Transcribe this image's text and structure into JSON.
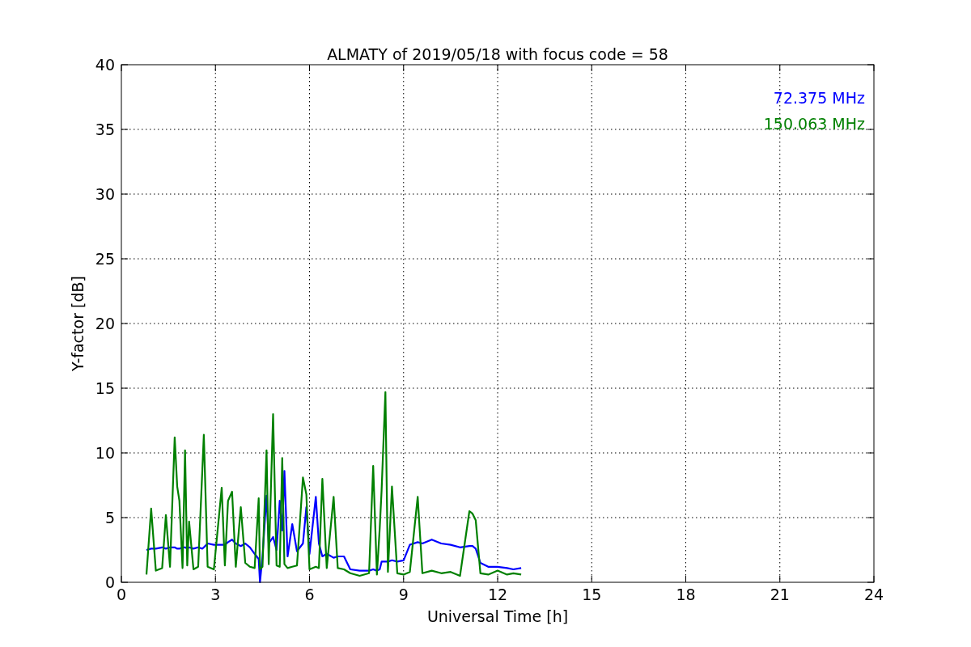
{
  "chart_data": {
    "type": "line",
    "grid": true,
    "title": "ALMATY of 2019/05/18 with focus code = 58",
    "xlabel": "Universal Time [h]",
    "ylabel": "Y-factor [dB]",
    "x": [
      0.8,
      0.95,
      1.1,
      1.3,
      1.42,
      1.55,
      1.7,
      1.78,
      1.85,
      1.95,
      2.03,
      2.1,
      2.16,
      2.3,
      2.45,
      2.58,
      2.63,
      2.75,
      2.95,
      3.2,
      3.3,
      3.4,
      3.53,
      3.65,
      3.81,
      3.95,
      4.1,
      4.25,
      4.38,
      4.42,
      4.5,
      4.63,
      4.7,
      4.84,
      4.95,
      5.05,
      5.13,
      5.2,
      5.3,
      5.45,
      5.6,
      5.79,
      5.9,
      6.0,
      6.2,
      6.3,
      6.41,
      6.55,
      6.77,
      6.9,
      7.1,
      7.3,
      7.6,
      7.9,
      8.03,
      8.15,
      8.24,
      8.3,
      8.42,
      8.5,
      8.63,
      8.8,
      9.0,
      9.2,
      9.45,
      9.6,
      9.9,
      10.2,
      10.5,
      10.8,
      11.1,
      11.2,
      11.3,
      11.45,
      11.7,
      12.0,
      12.3,
      12.5,
      12.75
    ],
    "series": [
      {
        "name": "72.375 MHz",
        "color": "#0000ff",
        "values": [
          2.5,
          2.6,
          2.6,
          2.7,
          2.6,
          2.7,
          2.7,
          2.6,
          2.6,
          2.7,
          2.7,
          2.6,
          2.7,
          2.6,
          2.7,
          2.6,
          2.7,
          3.0,
          2.9,
          2.9,
          2.9,
          3.1,
          3.3,
          3.0,
          2.8,
          3.0,
          2.7,
          2.2,
          1.8,
          0.0,
          2.0,
          6.7,
          3.0,
          3.5,
          2.5,
          6.3,
          4.0,
          8.6,
          2.0,
          4.5,
          2.4,
          3.0,
          5.8,
          2.2,
          6.6,
          3.0,
          2.0,
          2.2,
          1.9,
          2.0,
          2.0,
          1.0,
          0.9,
          0.9,
          1.0,
          0.9,
          1.0,
          1.6,
          1.6,
          1.6,
          1.7,
          1.6,
          1.7,
          2.9,
          3.1,
          3.0,
          3.3,
          3.0,
          2.9,
          2.7,
          2.8,
          2.8,
          2.6,
          1.5,
          1.2,
          1.2,
          1.1,
          1.0,
          1.1
        ]
      },
      {
        "name": "150.063 MHz",
        "color": "#008000",
        "values": [
          0.6,
          5.7,
          0.9,
          1.1,
          5.2,
          1.2,
          11.2,
          7.4,
          6.3,
          1.1,
          10.2,
          1.3,
          4.7,
          1.0,
          1.2,
          8.6,
          11.4,
          1.2,
          1.0,
          7.3,
          1.3,
          6.3,
          7.0,
          1.2,
          5.8,
          1.5,
          1.2,
          1.1,
          6.5,
          1.0,
          1.2,
          10.2,
          1.4,
          13.0,
          1.3,
          1.2,
          9.6,
          1.4,
          1.1,
          1.2,
          1.3,
          8.1,
          6.8,
          1.0,
          1.2,
          1.1,
          8.0,
          1.1,
          6.6,
          1.1,
          1.0,
          0.7,
          0.5,
          0.7,
          9.0,
          0.6,
          4.2,
          7.1,
          14.7,
          0.8,
          7.4,
          0.7,
          0.6,
          0.8,
          6.6,
          0.7,
          0.9,
          0.7,
          0.8,
          0.5,
          5.5,
          5.3,
          4.8,
          0.7,
          0.6,
          0.9,
          0.6,
          0.7,
          0.6
        ]
      }
    ],
    "xlim": [
      0,
      24
    ],
    "ylim": [
      0,
      40
    ],
    "xticks": [
      0,
      3,
      6,
      9,
      12,
      15,
      18,
      21,
      24
    ],
    "yticks": [
      0,
      5,
      10,
      15,
      20,
      25,
      30,
      35,
      40
    ]
  }
}
